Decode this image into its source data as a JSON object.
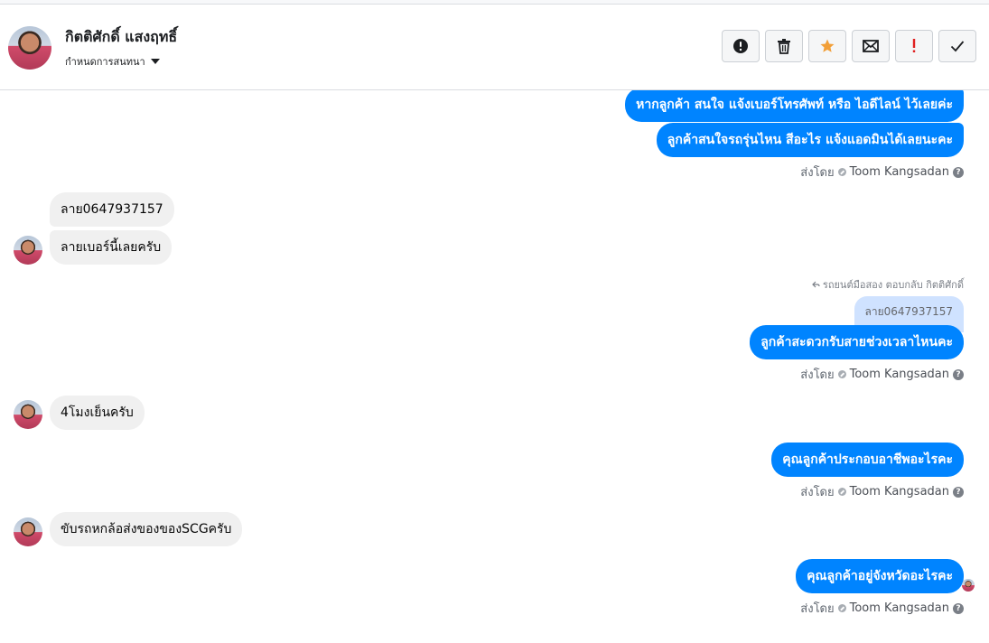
{
  "header": {
    "contact_name": "กิตติศักดิ์ แสงฤทธิ์",
    "assign_label": "กำหนดการสนทนา",
    "toolbar": [
      {
        "name": "spam-button",
        "icon": "alert-circle-icon"
      },
      {
        "name": "delete-button",
        "icon": "trash-icon"
      },
      {
        "name": "star-button",
        "icon": "star-icon"
      },
      {
        "name": "mark-unread-button",
        "icon": "envelope-icon"
      },
      {
        "name": "important-button",
        "icon": "exclamation-icon"
      },
      {
        "name": "done-button",
        "icon": "check-icon"
      }
    ]
  },
  "colors": {
    "outgoing_bubble": "#0084ff",
    "incoming_bubble": "#f0f0f0",
    "star": "#f29f38",
    "exclamation": "#e02020",
    "quote_bg": "#cfe2ff"
  },
  "messages": {
    "m1": "หากลูกค้า สนใจ แจ้งเบอร์โทรศัพท์ หรือ ไอดีไลน์  ไว้เลยค่ะ",
    "m2": "ลูกค้าสนใจรถรุ่นไหน สีอะไร แจ้งแอดมินได้เลยนะคะ",
    "m3": "ลาย0647937157",
    "m4": "ลายเบอร์นี้เลยครับ",
    "reply_note": "รถยนต์มือสอง ตอบกลับ กิตติศักดิ์",
    "quoted": "ลาย0647937157",
    "m5": "ลูกค้าสะดวกรับสายช่วงเวลาไหนคะ",
    "m6": "4โมงเย็นครับ",
    "m7": "คุณลูกค้าประกอบอาชีพอะไรคะ",
    "m8": "ขับรถหกล้อส่งของของSCGครับ",
    "m9": "คุณลูกค้าอยู่จังหวัดอะไรคะ"
  },
  "sent_by": {
    "prefix": "ส่งโดย",
    "agent": "Toom Kangsadan",
    "help": "?"
  }
}
